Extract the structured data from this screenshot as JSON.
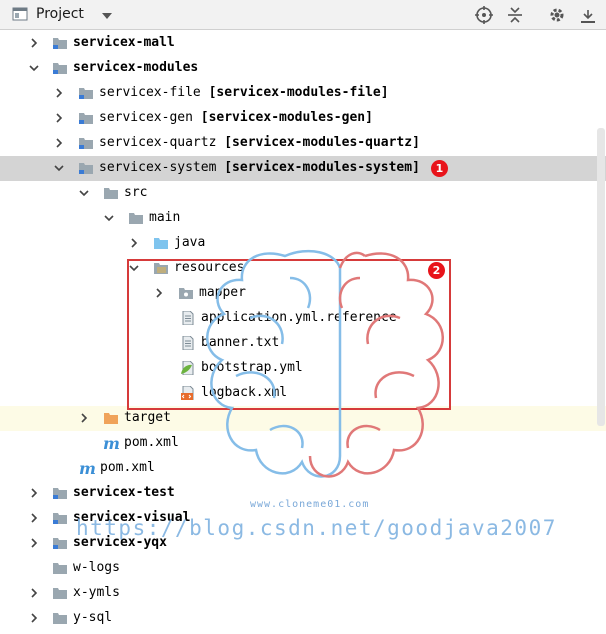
{
  "toolbar": {
    "title": "Project",
    "icons": [
      "project-view-icon",
      "dropdown-icon",
      "locate-icon",
      "collapse-icon",
      "settings-icon",
      "hide-icon"
    ]
  },
  "tree": [
    {
      "label": "servicex-mall",
      "bold": true,
      "suffix": "",
      "expanded": false,
      "icon": "module-folder"
    },
    {
      "label": "servicex-modules",
      "bold": true,
      "suffix": "",
      "expanded": true,
      "icon": "module-folder"
    },
    {
      "label": "servicex-file",
      "bold": false,
      "suffix": "[servicex-modules-file]",
      "expanded": false,
      "icon": "module-folder"
    },
    {
      "label": "servicex-gen",
      "bold": false,
      "suffix": "[servicex-modules-gen]",
      "expanded": false,
      "icon": "module-folder"
    },
    {
      "label": "servicex-quartz",
      "bold": false,
      "suffix": "[servicex-modules-quartz]",
      "expanded": false,
      "icon": "module-folder"
    },
    {
      "label": "servicex-system",
      "bold": false,
      "suffix": "[servicex-modules-system]",
      "expanded": true,
      "icon": "module-folder"
    },
    {
      "label": "src",
      "bold": false,
      "suffix": "",
      "expanded": true,
      "icon": "folder"
    },
    {
      "label": "main",
      "bold": false,
      "suffix": "",
      "expanded": true,
      "icon": "folder"
    },
    {
      "label": "java",
      "bold": false,
      "suffix": "",
      "expanded": false,
      "icon": "source-folder"
    },
    {
      "label": "resources",
      "bold": false,
      "suffix": "",
      "expanded": true,
      "icon": "resources-folder"
    },
    {
      "label": "mapper",
      "bold": false,
      "suffix": "",
      "expanded": false,
      "icon": "package-folder"
    },
    {
      "label": "application.yml.reference",
      "bold": false,
      "suffix": "",
      "expanded": null,
      "icon": "text-file"
    },
    {
      "label": "banner.txt",
      "bold": false,
      "suffix": "",
      "expanded": null,
      "icon": "text-file"
    },
    {
      "label": "bootstrap.yml",
      "bold": false,
      "suffix": "",
      "expanded": null,
      "icon": "spring-yml"
    },
    {
      "label": "logback.xml",
      "bold": false,
      "suffix": "",
      "expanded": null,
      "icon": "xml-file"
    },
    {
      "label": "target",
      "bold": false,
      "suffix": "",
      "expanded": false,
      "icon": "excluded-folder"
    },
    {
      "label": "pom.xml",
      "bold": false,
      "suffix": "",
      "expanded": null,
      "icon": "maven"
    },
    {
      "label": "pom.xml",
      "bold": false,
      "suffix": "",
      "expanded": null,
      "icon": "maven"
    },
    {
      "label": "servicex-test",
      "bold": true,
      "suffix": "",
      "expanded": false,
      "icon": "module-folder"
    },
    {
      "label": "servicex-visual",
      "bold": true,
      "suffix": "",
      "expanded": false,
      "icon": "module-folder"
    },
    {
      "label": "servicex-yqx",
      "bold": true,
      "suffix": "",
      "expanded": false,
      "icon": "module-folder"
    },
    {
      "label": "w-logs",
      "bold": false,
      "suffix": "",
      "expanded": null,
      "icon": "folder"
    },
    {
      "label": "x-ymls",
      "bold": false,
      "suffix": "",
      "expanded": false,
      "icon": "folder"
    },
    {
      "label": "y-sql",
      "bold": false,
      "suffix": "",
      "expanded": false,
      "icon": "folder"
    }
  ],
  "annotations": {
    "badge1": "1",
    "badge2": "2"
  },
  "watermark": {
    "url": "https://blog.csdn.net/goodjava2007",
    "small": "www.cloneme01.com"
  },
  "colors": {
    "selected": "#d4d4d4",
    "highlight": "#fdfbe6",
    "annotation_red": "#e8141b",
    "folder_gray": "#9aa7b0",
    "folder_blue": "#7fc4ee",
    "folder_orange": "#f0a35a",
    "maven_blue": "#3b8fd6"
  }
}
